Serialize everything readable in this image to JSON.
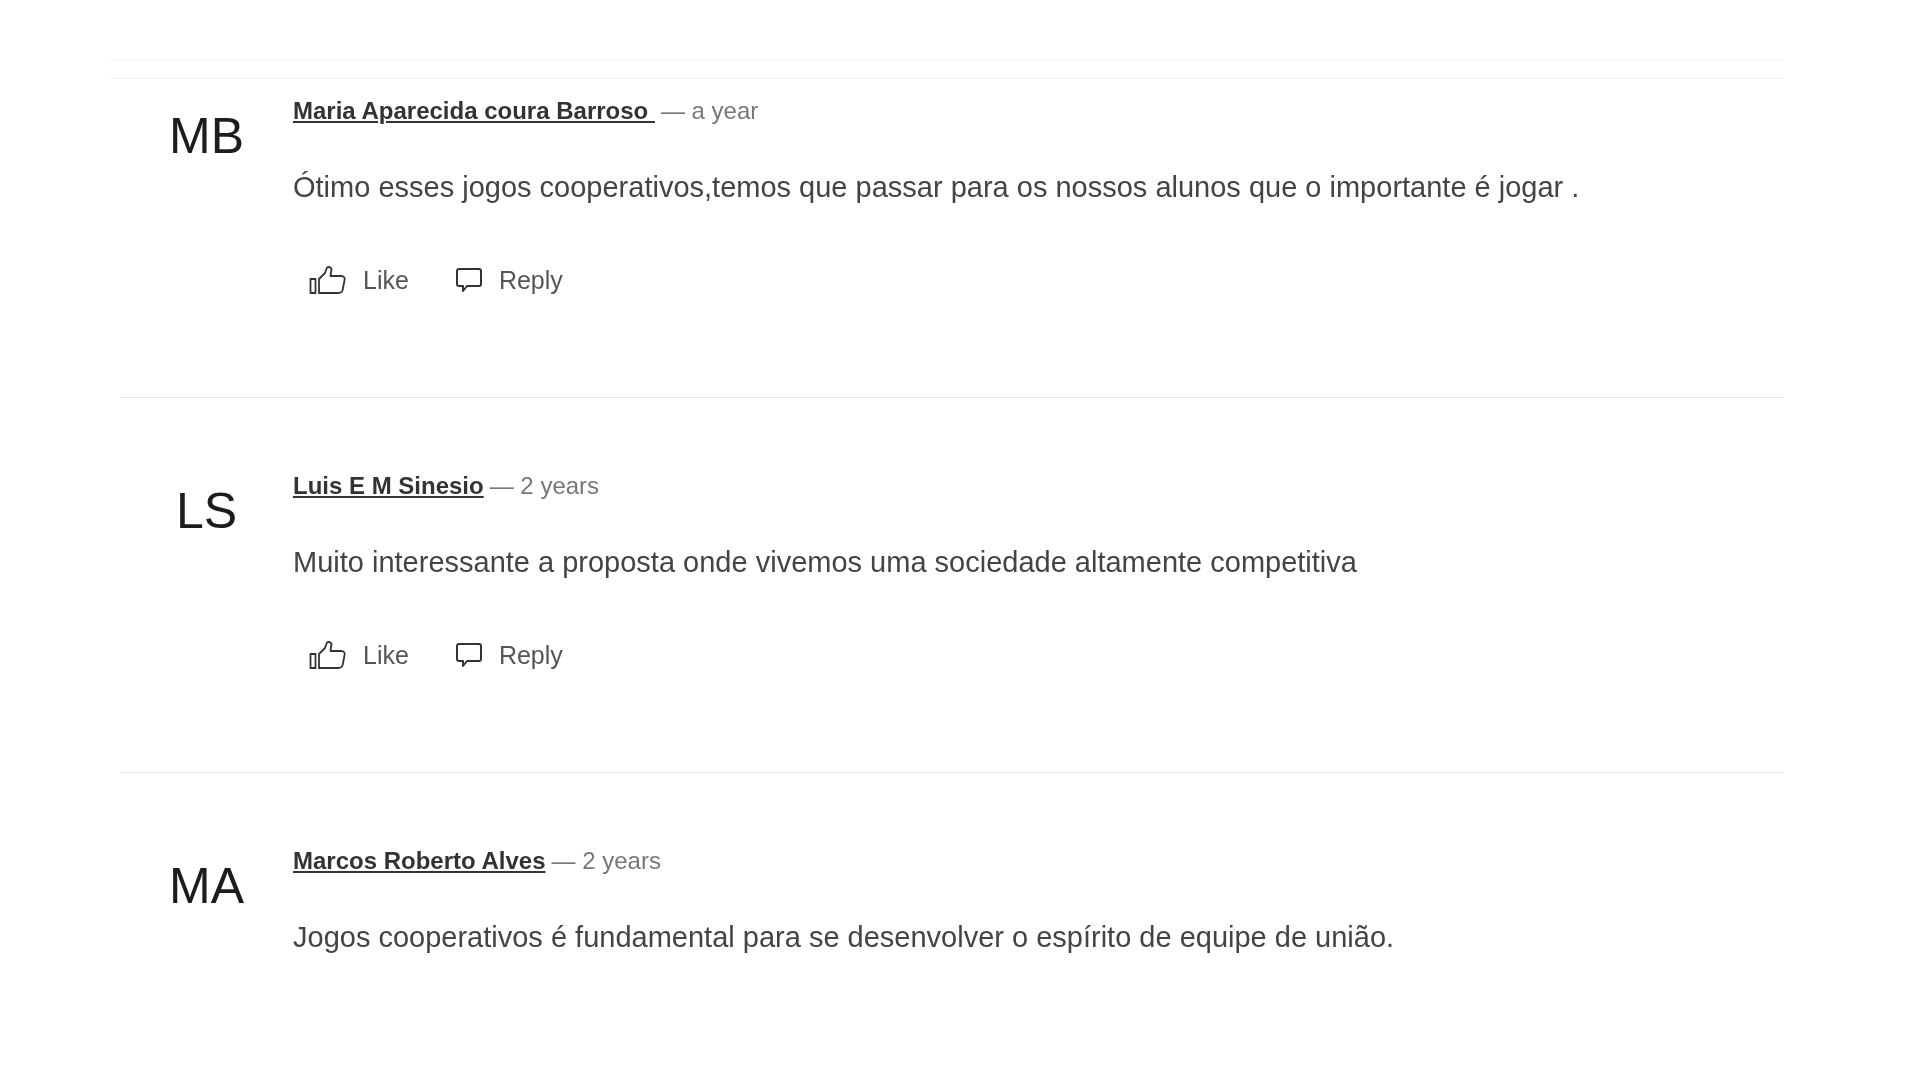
{
  "comments": [
    {
      "initials": "MB",
      "author": "Maria Aparecida coura Barroso ",
      "time": "— a year",
      "text": "Ótimo esses jogos cooperativos,temos que passar para os nossos alunos que o importante é jogar .",
      "actions": [
        {
          "kind": "like",
          "label": "Like"
        },
        {
          "kind": "reply",
          "label": "Reply"
        }
      ]
    },
    {
      "initials": "LS",
      "author": "Luis E M Sinesio",
      "time": "— 2 years",
      "text": "Muito interessante a proposta onde vivemos uma sociedade altamente competitiva",
      "actions": [
        {
          "kind": "like",
          "label": "Like"
        },
        {
          "kind": "reply",
          "label": "Reply"
        }
      ]
    },
    {
      "initials": "MA",
      "author": "Marcos Roberto Alves",
      "time": "— 2 years",
      "text": "Jogos cooperativos é fundamental para se desenvolver o espírito de equipe de união."
    }
  ]
}
